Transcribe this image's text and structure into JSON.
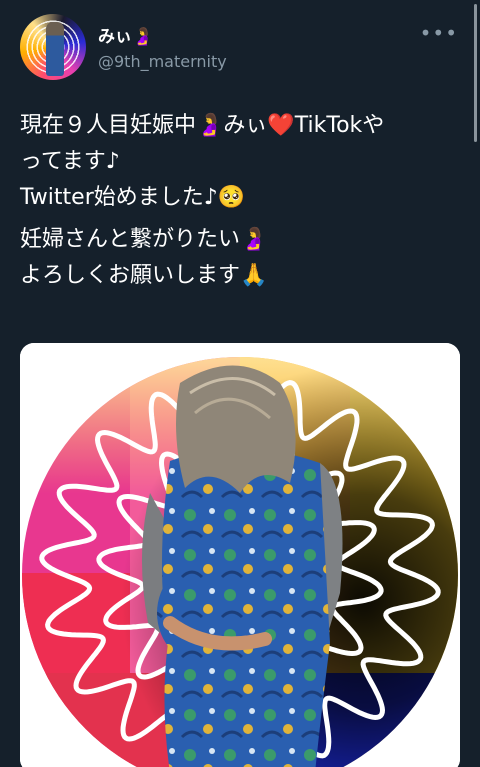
{
  "tweet": {
    "display_name": "みぃ🤰",
    "handle": "@9th_maternity",
    "more_label": "•••",
    "text_block_1": "現在９人目妊娠中🤰みぃ❤️TikTokや\nってます♪\nTwitter始めました♪🥺",
    "text_block_2": "妊婦さんと繋がりたい🤰\nよろしくお願いします🙏"
  },
  "colors": {
    "background": "#15202b",
    "secondary_text": "#8899a6",
    "primary_text": "#ffffff"
  },
  "icons": [
    "more-icon"
  ]
}
